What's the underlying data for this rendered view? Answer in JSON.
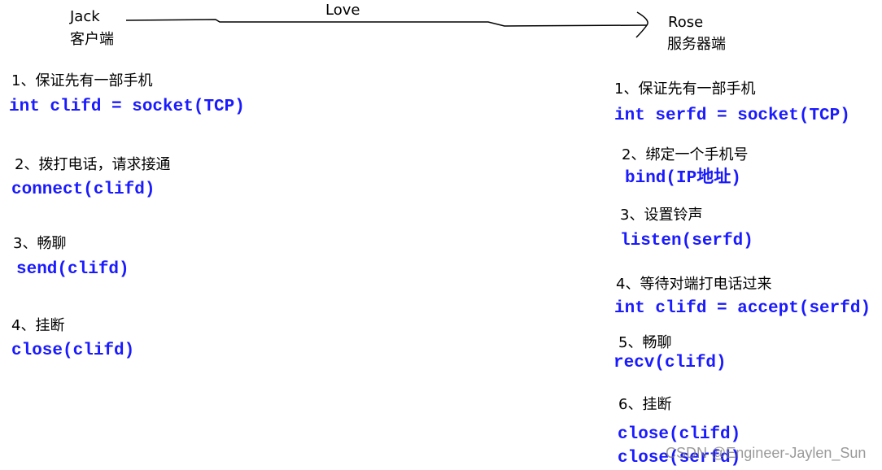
{
  "client": {
    "name": "Jack",
    "role": "客户端"
  },
  "server": {
    "name": "Rose",
    "role": "服务器端"
  },
  "arrow_label": "Love",
  "client_steps": [
    {
      "label": "1、保证先有一部手机",
      "code": "int clifd = socket(TCP)"
    },
    {
      "label": "2、拨打电话，请求接通",
      "code": "connect(clifd)"
    },
    {
      "label": "3、畅聊",
      "code": "send(clifd)"
    },
    {
      "label": "4、挂断",
      "code": "close(clifd)"
    }
  ],
  "server_steps": [
    {
      "label": "1、保证先有一部手机",
      "code": "int serfd = socket(TCP)"
    },
    {
      "label": "2、绑定一个手机号",
      "code": "bind(IP地址)"
    },
    {
      "label": "3、设置铃声",
      "code": "listen(serfd)"
    },
    {
      "label": "4、等待对端打电话过来",
      "code": "int clifd = accept(serfd)"
    },
    {
      "label": "5、畅聊",
      "code": "recv(clifd)"
    },
    {
      "label": "6、挂断",
      "code": "close(clifd)",
      "code2": "close(serfd)"
    }
  ],
  "watermark": "CSDN @Engineer-Jaylen_Sun"
}
